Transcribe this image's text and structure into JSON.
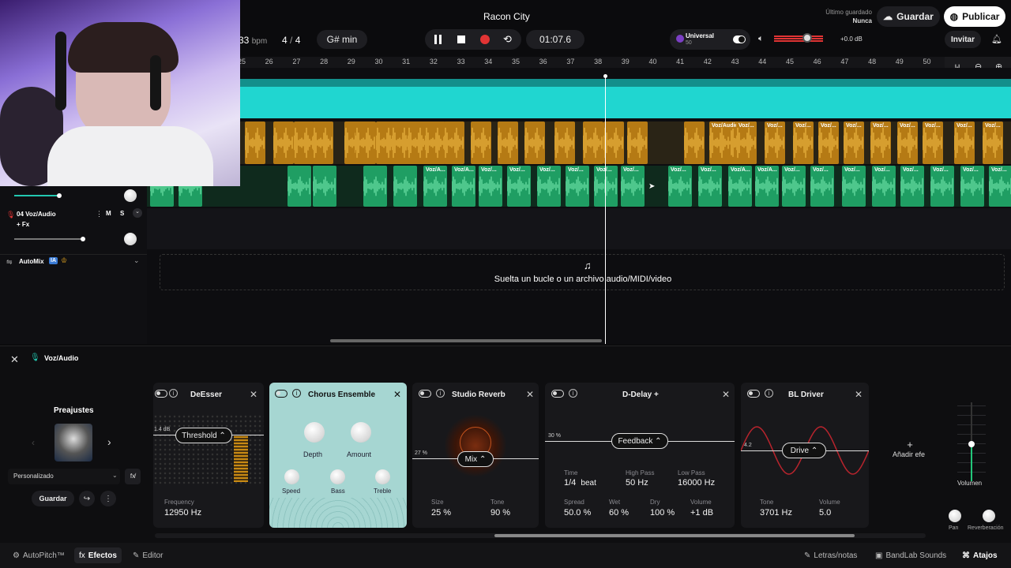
{
  "project": {
    "title": "Racon City"
  },
  "transport": {
    "bpm_value": "33",
    "bpm_unit": "bpm",
    "time_sig_top": "4",
    "time_sig_sep": "/",
    "time_sig_bottom": "4",
    "key": "G# min",
    "time": "01:07.6"
  },
  "header_right": {
    "last_saved_label": "Último guardado",
    "last_saved_value": "Nunca",
    "save_label": "Guardar",
    "publish_label": "Publicar",
    "invite_label": "Invitar",
    "master_volume": "+0.0 dB"
  },
  "mastering": {
    "preset_name": "Universal",
    "preset_value": "50"
  },
  "ruler": {
    "ticks": [
      "25",
      "26",
      "27",
      "28",
      "29",
      "30",
      "31",
      "32",
      "33",
      "34",
      "35",
      "36",
      "37",
      "38",
      "39",
      "40",
      "41",
      "42",
      "43",
      "44",
      "45",
      "46",
      "47",
      "48",
      "49",
      "50"
    ]
  },
  "tracks": [
    {
      "number": "04",
      "name": "Voz/Audio",
      "fx_label": "+ Fx",
      "mute": "M",
      "solo": "S"
    }
  ],
  "automix": {
    "label": "AutoMix",
    "badge": "IA"
  },
  "clips": {
    "label_full": "Voz/Audio",
    "label_short": "Voz/...",
    "label_mid": "Voz/A..."
  },
  "dropzone": {
    "text": "Suelta un bucle o un archivo audio/MIDI/video"
  },
  "fx_panel": {
    "track_name": "Voz/Audio",
    "presets_title": "Preajustes",
    "preset_select": "Personalizado",
    "save_button": "Guardar",
    "add_effect": "Añadir efe",
    "volume_label": "Volumen",
    "pan_label": "Pan",
    "reverb_label": "Reverberación",
    "effects": {
      "deesser": {
        "title": "DeEsser",
        "control": "Threshold",
        "db_marker": "1.4 dB",
        "freq_label": "Frequency",
        "freq_value": "12950 Hz"
      },
      "chorus": {
        "title": "Chorus Ensemble",
        "depth": "Depth",
        "amount": "Amount",
        "speed": "Speed",
        "bass": "Bass",
        "treble": "Treble"
      },
      "reverb": {
        "title": "Studio Reverb",
        "control": "Mix",
        "pct_marker": "27 %",
        "size_label": "Size",
        "size_value": "25 %",
        "tone_label": "Tone",
        "tone_value": "90 %"
      },
      "delay": {
        "title": "D-Delay +",
        "control": "Feedback",
        "pct_marker": "30 %",
        "time_label": "Time",
        "time_value": "1/4",
        "time_unit": "beat",
        "hp_label": "High Pass",
        "hp_value": "50 Hz",
        "lp_label": "Low Pass",
        "lp_value": "16000 Hz",
        "spread_label": "Spread",
        "spread_value": "50.0 %",
        "wet_label": "Wet",
        "wet_value": "60 %",
        "dry_label": "Dry",
        "dry_value": "100 %",
        "vol_label": "Volume",
        "vol_value": "+1 dB"
      },
      "driver": {
        "title": "BL Driver",
        "control": "Drive",
        "marker": "4.2",
        "tone_label": "Tone",
        "tone_value": "3701 Hz",
        "vol_label": "Volume",
        "vol_value": "5.0"
      }
    }
  },
  "bottom_bar": {
    "autopitch": "AutoPitch™",
    "effects": "Efectos",
    "editor": "Editor",
    "lyrics": "Letras/notas",
    "sounds": "BandLab Sounds",
    "shortcuts": "Atajos"
  },
  "colors": {
    "cyan_track": "#20d6d0",
    "yellow_clip": "#e0a11f",
    "green_clip": "#22b46e",
    "record": "#e23434",
    "chorus_bg": "#a6d6d2"
  }
}
